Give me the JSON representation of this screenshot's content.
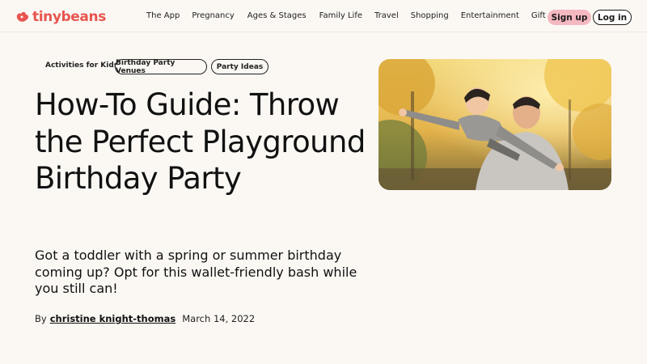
{
  "header": {
    "logo_text": "tinybeans",
    "nav": [
      "The App",
      "Pregnancy",
      "Ages & Stages",
      "Family Life",
      "Travel",
      "Shopping",
      "Entertainment",
      "Gift Cards"
    ],
    "signup_label": "Sign up",
    "login_label": "Log in"
  },
  "article": {
    "category": "Activities for Kids",
    "tags": [
      "Birthday Party Venues",
      "Party Ideas"
    ],
    "title": "How-To Guide: Throw the Perfect Playground Birthday Party",
    "dek": "Got a toddler with a spring or summer birthday coming up? Opt for this wallet-friendly bash while you still can!",
    "byline_prefix": "By",
    "author": "christine knight-thomas",
    "date": "March 14, 2022",
    "hero_image": "father-piggyback-child-autumn-trees"
  },
  "colors": {
    "brand": "#e8554f",
    "signup_bg": "#f4b8c0",
    "page_bg": "#fbf8f4"
  }
}
